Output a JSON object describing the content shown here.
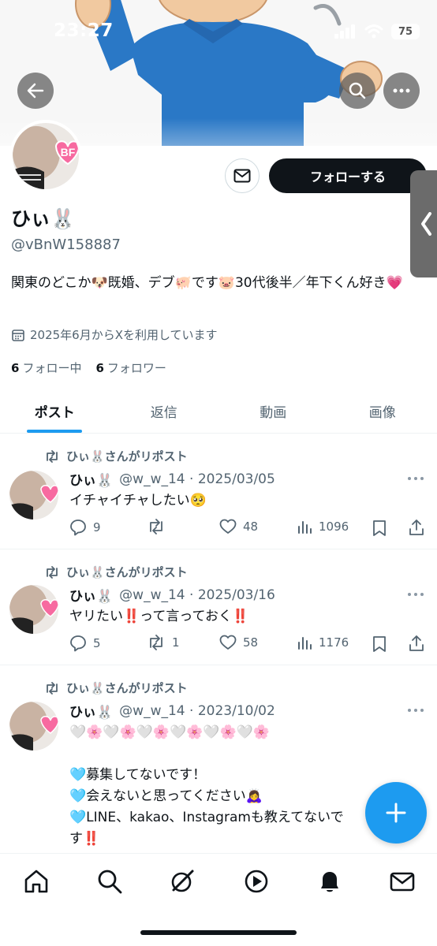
{
  "status_bar": {
    "time": "23:27",
    "battery": "75"
  },
  "profile": {
    "display_name": "ひぃ🐰",
    "handle": "@vBnW158887",
    "bio": "関東のどこか🐶既婚、デブ🐖です🐷30代後半／年下くん好き💗",
    "joined": "2025年6月からXを利用しています",
    "following_count": "6",
    "following_label": "フォロー中",
    "followers_count": "6",
    "followers_label": "フォロワー",
    "follow_button": "フォローする",
    "avatar_badge": "BF"
  },
  "tabs": [
    {
      "label": "ポスト",
      "active": true
    },
    {
      "label": "返信",
      "active": false
    },
    {
      "label": "動画",
      "active": false
    },
    {
      "label": "画像",
      "active": false
    }
  ],
  "posts": [
    {
      "repost_label": "ひぃ🐰さんがリポスト",
      "name": "ひぃ🐰",
      "handle_date": "@w_w_14 · 2025/03/05",
      "text": "イチャイチャしたい🥺",
      "replies": "9",
      "reposts": "",
      "likes": "48",
      "views": "1096"
    },
    {
      "repost_label": "ひぃ🐰さんがリポスト",
      "name": "ひぃ🐰",
      "handle_date": "@w_w_14 · 2025/03/16",
      "text": "ヤリたい‼️って言っておく‼️",
      "replies": "5",
      "reposts": "1",
      "likes": "58",
      "views": "1176"
    },
    {
      "repost_label": "ひぃ🐰さんがリポスト",
      "name": "ひぃ🐰",
      "handle_date": "@w_w_14 · 2023/10/02",
      "text": "🤍🌸🤍🌸🤍🌸🤍🌸🤍🌸🤍🌸\n\n🩵募集してないです！\n🩵会えないと思ってください🙇‍♀️\n🩵LINE、kakao、Instagramも教えてないです‼️"
    }
  ],
  "colors": {
    "accent": "#1d9bf0",
    "text": "#0f1419",
    "muted": "#536471",
    "banner_shirt": "#2a78c6"
  },
  "icons": {
    "back": "arrow-left-icon",
    "search": "search-icon",
    "more": "more-icon",
    "message": "mail-icon",
    "compose": "plus-icon",
    "nav": [
      "home-icon",
      "search-icon",
      "grok-icon",
      "video-icon",
      "bell-icon",
      "mail-icon"
    ]
  }
}
